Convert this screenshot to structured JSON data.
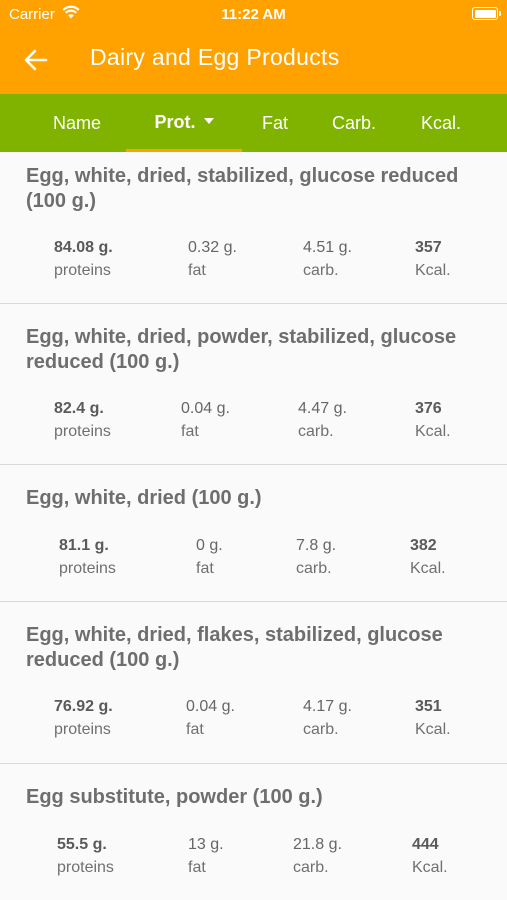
{
  "status": {
    "carrier": "Carrier",
    "time": "11:22 AM"
  },
  "header": {
    "title": "Dairy and Egg Products"
  },
  "tabs": [
    {
      "label": "Name"
    },
    {
      "label": "Prot."
    },
    {
      "label": "Fat"
    },
    {
      "label": "Carb."
    },
    {
      "label": "Kcal."
    }
  ],
  "labels": {
    "proteins": "proteins",
    "fat": "fat",
    "carb": "carb.",
    "kcal": "Kcal."
  },
  "items": [
    {
      "name": "Egg, white, dried, stabilized, glucose reduced (100 g.)",
      "proteins": "84.08 g.",
      "fat": "0.32 g.",
      "carb": "4.51 g.",
      "kcal": "357"
    },
    {
      "name": "Egg, white, dried, powder, stabilized, glucose reduced (100 g.)",
      "proteins": "82.4 g.",
      "fat": "0.04 g.",
      "carb": "4.47 g.",
      "kcal": "376"
    },
    {
      "name": "Egg, white, dried (100 g.)",
      "proteins": "81.1 g.",
      "fat": "0 g.",
      "carb": "7.8 g.",
      "kcal": "382"
    },
    {
      "name": "Egg, white, dried, flakes, stabilized, glucose reduced (100 g.)",
      "proteins": "76.92 g.",
      "fat": "0.04 g.",
      "carb": "4.17 g.",
      "kcal": "351"
    },
    {
      "name": "Egg substitute, powder (100 g.)",
      "proteins": "55.5 g.",
      "fat": "13 g.",
      "carb": "21.8 g.",
      "kcal": "444"
    }
  ]
}
